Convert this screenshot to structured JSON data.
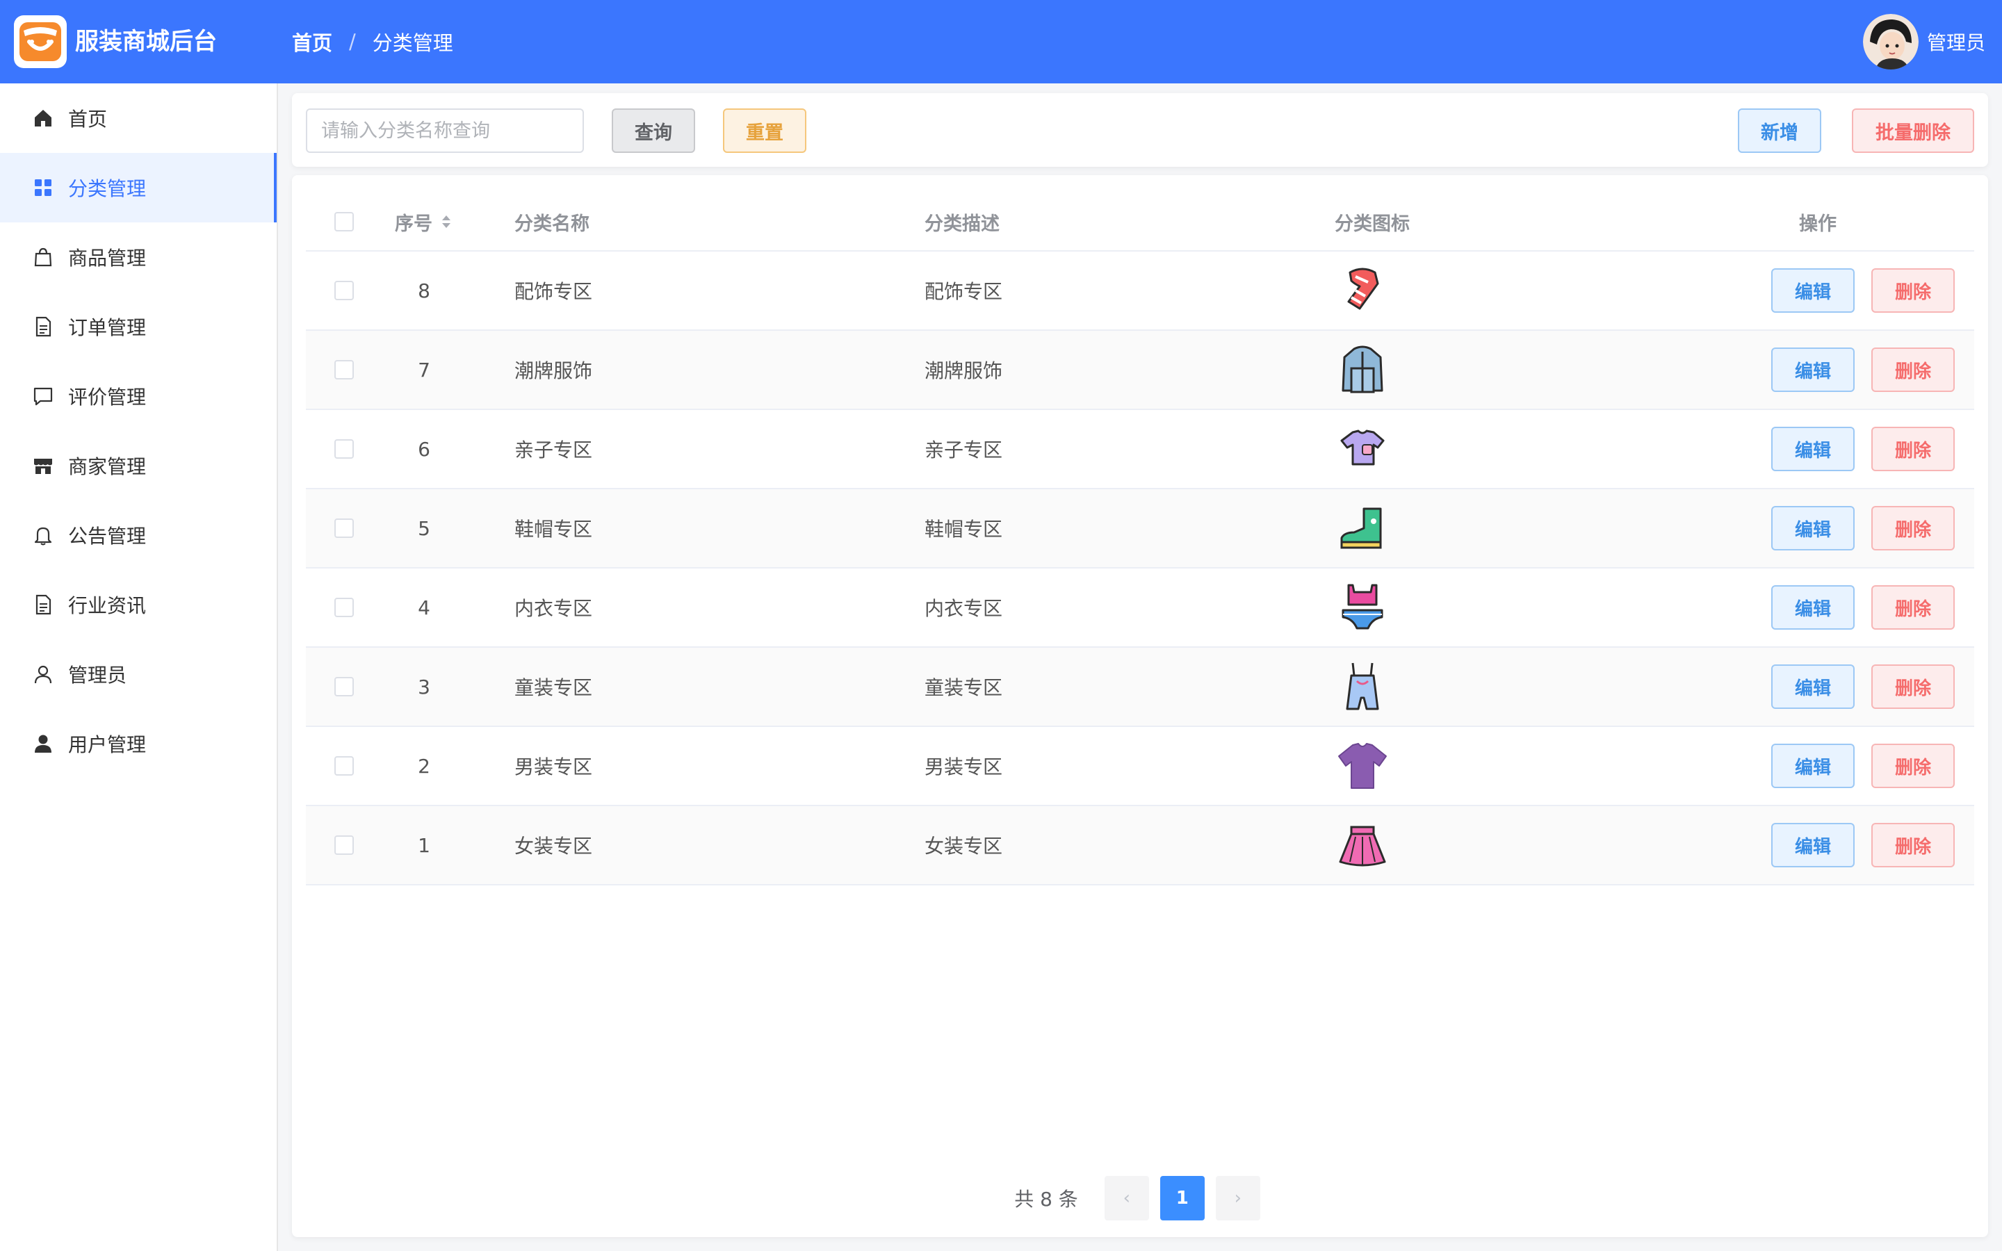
{
  "app": {
    "brand": "服装商城后台",
    "accent": "#3b76fe"
  },
  "breadcrumb": {
    "home": "首页",
    "separator": "/",
    "current": "分类管理"
  },
  "user": {
    "name": "管理员"
  },
  "sidebar": {
    "items": [
      {
        "label": "首页",
        "icon": "home-icon"
      },
      {
        "label": "分类管理",
        "icon": "grid-icon",
        "active": true
      },
      {
        "label": "商品管理",
        "icon": "shopping-bag-icon"
      },
      {
        "label": "订单管理",
        "icon": "document-icon"
      },
      {
        "label": "评价管理",
        "icon": "chat-icon"
      },
      {
        "label": "商家管理",
        "icon": "shop-icon"
      },
      {
        "label": "公告管理",
        "icon": "bell-icon"
      },
      {
        "label": "行业资讯",
        "icon": "document-icon"
      },
      {
        "label": "管理员",
        "icon": "user-outline-icon"
      },
      {
        "label": "用户管理",
        "icon": "user-filled-icon"
      }
    ]
  },
  "search": {
    "placeholder": "请输入分类名称查询",
    "value": "",
    "query_label": "查询",
    "reset_label": "重置",
    "add_label": "新增",
    "batch_delete_label": "批量删除"
  },
  "table": {
    "columns": {
      "seq": "序号",
      "name": "分类名称",
      "desc": "分类描述",
      "icon": "分类图标",
      "op": "操作"
    },
    "edit_label": "编辑",
    "delete_label": "删除",
    "rows": [
      {
        "seq": "8",
        "name": "配饰专区",
        "desc": "配饰专区",
        "icon": "scarf-icon"
      },
      {
        "seq": "7",
        "name": "潮牌服饰",
        "desc": "潮牌服饰",
        "icon": "jacket-icon"
      },
      {
        "seq": "6",
        "name": "亲子专区",
        "desc": "亲子专区",
        "icon": "kids-shirt-icon"
      },
      {
        "seq": "5",
        "name": "鞋帽专区",
        "desc": "鞋帽专区",
        "icon": "boot-icon"
      },
      {
        "seq": "4",
        "name": "内衣专区",
        "desc": "内衣专区",
        "icon": "underwear-icon"
      },
      {
        "seq": "3",
        "name": "童装专区",
        "desc": "童装专区",
        "icon": "overalls-icon"
      },
      {
        "seq": "2",
        "name": "男装专区",
        "desc": "男装专区",
        "icon": "tshirt-icon"
      },
      {
        "seq": "1",
        "name": "女装专区",
        "desc": "女装专区",
        "icon": "skirt-icon"
      }
    ]
  },
  "pagination": {
    "total_text": "共 8 条",
    "current_page": "1",
    "prev": "‹",
    "next": "›"
  }
}
